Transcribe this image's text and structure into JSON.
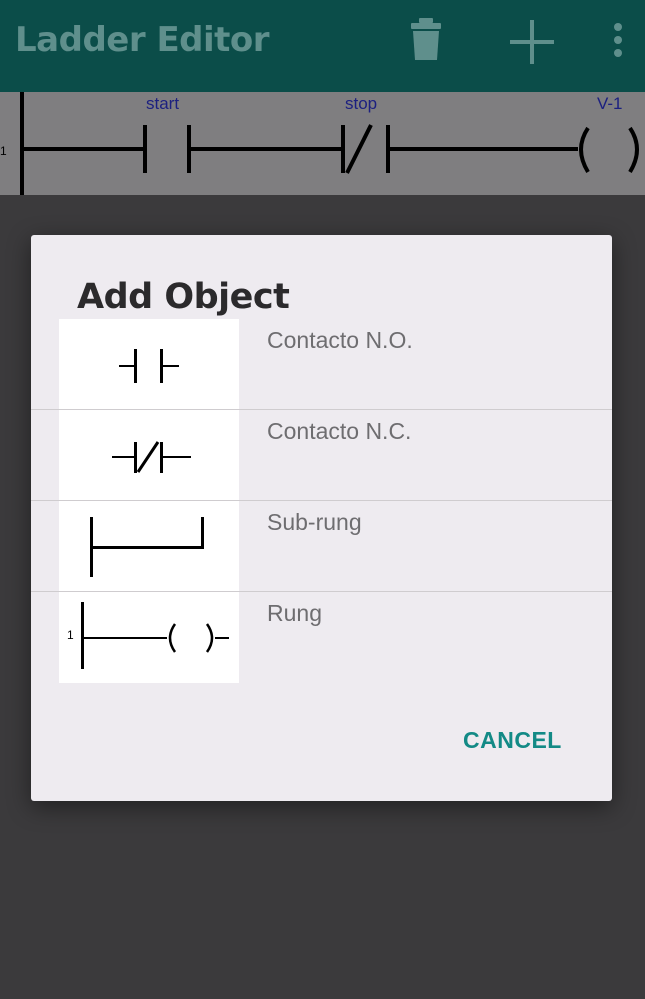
{
  "appbar": {
    "title": "Ladder Editor",
    "actions": [
      "trash-icon",
      "plus-icon",
      "more-vert-icon"
    ],
    "background": "#0b4d49"
  },
  "canvas": {
    "rung_number": "1",
    "labels": {
      "contact1": "start",
      "contact2": "stop",
      "coil": "V-1"
    }
  },
  "dialog": {
    "title": "Add Object",
    "options": [
      {
        "label": "Contacto N.O.",
        "icon": "normally-open-contact-icon"
      },
      {
        "label": "Contacto N.C.",
        "icon": "normally-closed-contact-icon"
      },
      {
        "label": "Sub-rung",
        "icon": "sub-rung-icon"
      },
      {
        "label": "Rung",
        "icon": "rung-icon",
        "rung_number": "1"
      }
    ],
    "cancel_label": "CANCEL",
    "accent": "#138a86"
  }
}
